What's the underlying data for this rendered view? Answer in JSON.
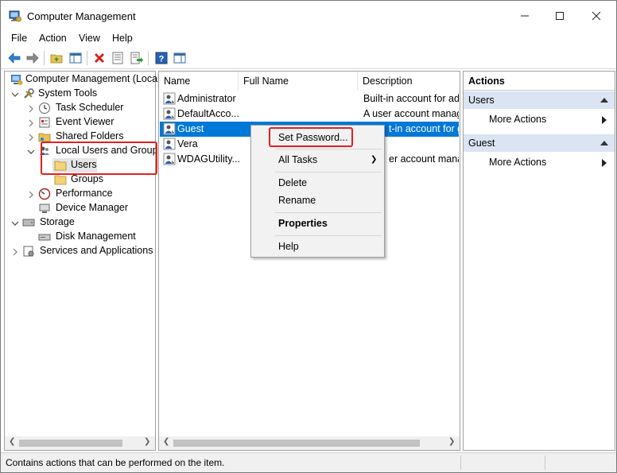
{
  "window": {
    "title": "Computer Management"
  },
  "menubar": {
    "items": [
      "File",
      "Action",
      "View",
      "Help"
    ]
  },
  "tree": {
    "root": "Computer Management (Local",
    "system_tools": "System Tools",
    "task_scheduler": "Task Scheduler",
    "event_viewer": "Event Viewer",
    "shared_folders": "Shared Folders",
    "local_users_groups": "Local Users and Groups",
    "users": "Users",
    "groups": "Groups",
    "performance": "Performance",
    "device_manager": "Device Manager",
    "storage": "Storage",
    "disk_management": "Disk Management",
    "services_apps": "Services and Applications"
  },
  "list": {
    "columns": [
      "Name",
      "Full Name",
      "Description"
    ],
    "rows": [
      {
        "name": "Administrator",
        "full_name": "",
        "description": "Built-in account for adı"
      },
      {
        "name": "DefaultAcco...",
        "full_name": "",
        "description": "A user account manage"
      },
      {
        "name": "Guest",
        "full_name": "",
        "description": "t-in account for gu"
      },
      {
        "name": "Vera",
        "full_name": "",
        "description": ""
      },
      {
        "name": "WDAGUtility...",
        "full_name": "",
        "description": "er account manage"
      }
    ]
  },
  "context_menu": {
    "set_password": "Set Password...",
    "all_tasks": "All Tasks",
    "delete": "Delete",
    "rename": "Rename",
    "properties": "Properties",
    "help": "Help"
  },
  "actions": {
    "title": "Actions",
    "users_header": "Users",
    "users_more": "More Actions",
    "guest_header": "Guest",
    "guest_more": "More Actions"
  },
  "status": {
    "text": "Contains actions that can be performed on the item."
  },
  "colors": {
    "selection": "#0078d7",
    "highlight_box": "#e0201e",
    "action_header": "#dae4f2"
  }
}
